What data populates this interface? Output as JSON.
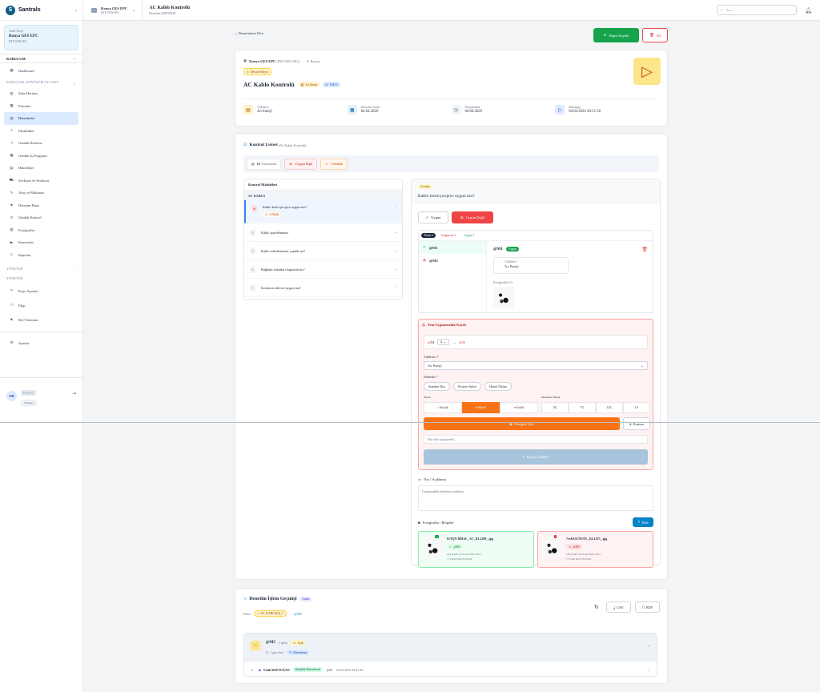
{
  "sidebar": {
    "brand": "Santrals",
    "project_label": "Aktif Proje",
    "project_name": "Konya GES EPC",
    "project_code": "INT-GES-001",
    "sec_kurulum": "KURULUM",
    "dashboard": "Dashboard",
    "sub_section": "KURULUM, DÖNÜŞÜM VE TEST",
    "items": [
      "Saha Haritası",
      "Firmalar",
      "Denetimler",
      "Eksiklikler",
      "Günlük İlerleme",
      "Günlük İş Programı",
      "Hakedişler",
      "Sevkiyat ve Sevkiyat",
      "Araç ve Makinası",
      "Denetim Planı",
      "Günlük Kontrol",
      "Fotoğraflar",
      "Kameralar",
      "Raporlar"
    ],
    "sec_yonetim": "YÖNETİM",
    "sec_yonetim2": "YÖNETİM",
    "admin_items": [
      "Proje Ayarları",
      "Ekip",
      "Rol Yönetimi"
    ],
    "settings": "Ayarlar",
    "user_initials": "FB",
    "user_name": "Fatih B.",
    "user_role": "Yönetici"
  },
  "topbar": {
    "project": "Konya GES EPC",
    "project_code": "INT-GES-001",
    "title": "AC Kablo Kontrolü",
    "subtitle": "Denetim #38839028",
    "search_placeholder": "Ara..."
  },
  "actions": {
    "back": "Denetimlere Dön",
    "start": "Hepsi Kaydet",
    "delete": "Sil"
  },
  "summary": {
    "project": "Konya GES EPC",
    "project_code": "(INT-GES-001)",
    "location": "Konya",
    "status": "Devam Ediyor",
    "title": "AC Kablo Kontrolü",
    "company_tag": "Ax Enerji",
    "team_tag": "TM1-5",
    "meta": [
      {
        "label": "Yüklenici",
        "value": "Ax Enerji"
      },
      {
        "label": "Denetim Tarihi",
        "value": "04.04.2026"
      },
      {
        "label": "Oluşturulma",
        "value": "04.04.2026"
      },
      {
        "label": "Başlangıç",
        "value": "04.04.2026 20:51:56"
      }
    ]
  },
  "checklist": {
    "title": "Kontrol Listesi",
    "subtitle": "(AC Kablo Kontrolü)",
    "stats": [
      {
        "text": "1/5",
        "label": "Tamamlandı"
      },
      {
        "text": "1",
        "label": "Uygun Değil"
      },
      {
        "text": "1",
        "label": "Eksiklik"
      }
    ],
    "left_header": "Kontrol Maddeleri",
    "group": "AC KABLO",
    "items": [
      {
        "n": "!",
        "text": "Kablo kesiti projeye uygun mu?",
        "tag": "1 Eksik"
      },
      {
        "n": "2",
        "text": "Kablo işaretlenması"
      },
      {
        "n": "3",
        "text": "Kablo etiketlenmesi yapıldı mı?"
      },
      {
        "n": "4",
        "text": "Bağlantı noktaları kapatıldı mı?"
      },
      {
        "n": "5",
        "text": "İzolasyon direnci uygun mu?"
      }
    ],
    "required_tag": "Zorunlu",
    "question": "Kablo kesiti projeye uygun mu?",
    "btn_ok": "Uygun",
    "btn_nok": "Uygun Değil",
    "tabs": [
      {
        "label": "Tümü",
        "count": "2"
      },
      {
        "label": "Uygunsuz",
        "count": "1"
      },
      {
        "label": "Uygun",
        "count": "1"
      }
    ],
    "list": [
      "@M1",
      "@M5"
    ],
    "detail_id": "@M1",
    "detail_badge": "Uygun",
    "detail_label": "Yüklenici",
    "detail_value": "Ax Enerji",
    "photos_label": "Fotoğraflar (1)"
  },
  "nc_form": {
    "title": "Yeni Uygunsuzluk Kaydı",
    "range_from": "M",
    "range_to": "@M",
    "contractor_label": "Yüklenici *",
    "contractor_value": "Ax Enerji",
    "reasons_label": "Nedenler *",
    "reasons": [
      "Standart Dışı",
      "Projeye Aykırı",
      "Hatalı Ölçüm"
    ],
    "severity_label": "Önem",
    "severity": [
      "Küçük",
      "Büyük",
      "Kritik"
    ],
    "deadline_label": "Düzeltme Süresi",
    "deadlines": [
      "3G",
      "7G",
      "14G",
      "1A"
    ],
    "photo_btn": "Fotoğraf Çek",
    "location_btn": "Konum",
    "note_placeholder": "Not ekle (opsiyonel)...",
    "save_btn": "Kaydet (@M1)"
  },
  "notes": {
    "label": "Not / Açıklama",
    "placeholder": "Uygunsuzluk nedenini açıklayın..."
  },
  "attachments": {
    "label": "Fotoğraflar / Belgeler",
    "upload": "Ekle",
    "files": [
      {
        "name": "61TQY-MDAL_AC_KL1280_.jpg",
        "badge": "@M1",
        "size": "125.9 KB",
        "date": "04.04.2026 20:41",
        "user": "Fatih BAYTUĞAN",
        "type": "ok"
      },
      {
        "name": "7rx6A3CNOTL_KL1473_.jpg",
        "badge": "@M5",
        "size": "130.9 KB",
        "date": "04.04.2026 20:41",
        "user": "Fatih BAYTUĞAN",
        "type": "nok"
      }
    ]
  },
  "history": {
    "title": "Denetim İşlem Geçmişi",
    "count_badge": "Canlı",
    "filter_label": "Filtre:",
    "filter_chip": "AC_KABLO(4)_1",
    "filter_tag": "@M5",
    "btn_csv": "CSV",
    "btn_pdf": "PDF",
    "group_id": "@M5",
    "group_sub": "1 işlem",
    "group_tag": "Açık",
    "group_time": "1 gün önce",
    "group_status": "Düzenleme",
    "row_user": "Fatih BAYTUĞAN",
    "row_tag": "Eksiklik Düzenlendi",
    "row_id": "@M",
    "row_time": "04.04.2026 20:41:30"
  }
}
